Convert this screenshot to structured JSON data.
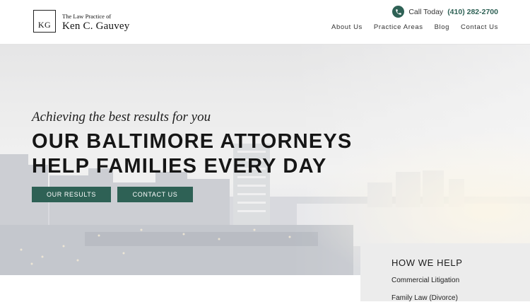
{
  "header": {
    "logo": {
      "mark": "KG",
      "subtitle": "The Law Practice of",
      "name": "Ken C. Gauvey"
    },
    "call": {
      "icon": "phone-icon",
      "label": "Call Today",
      "number": "(410) 282-2700"
    },
    "nav": [
      "About Us",
      "Practice Areas",
      "Blog",
      "Contact Us"
    ]
  },
  "hero": {
    "tagline": "Achieving the best results for you",
    "title_line1": "OUR BALTIMORE ATTORNEYS",
    "title_line2": "HELP FAMILIES EVERY DAY",
    "buttons": {
      "results": "OUR RESULTS",
      "contact": "CONTACT US"
    }
  },
  "how_we_help": {
    "title": "HOW WE HELP",
    "items": [
      "Commercial Litigation",
      "Family Law (Divorce)"
    ]
  },
  "colors": {
    "accent": "#2e6155",
    "panel": "#ececec"
  }
}
